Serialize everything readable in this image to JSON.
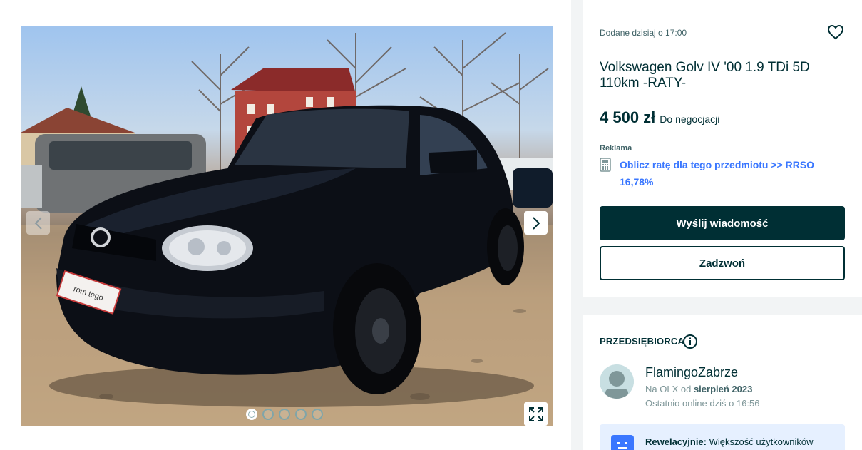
{
  "listing": {
    "added": "Dodane dzisiaj o 17:00",
    "title": "Volkswagen Golv IV '00 1.9 TDi 5D 110km -RATY-",
    "price": "4 500 zł",
    "negotiable": "Do negocjacji",
    "ad_label": "Reklama",
    "calculator_link": "Oblicz ratę dla tego przedmiotu >> RRSO 16,78%",
    "message_button": "Wyślij wiadomość",
    "call_button": "Zadzwoń"
  },
  "gallery": {
    "photo_count": 5,
    "active_index": 0,
    "plate_text": "rom tego"
  },
  "seller": {
    "type_label": "PRZEDSIĘBIORCA",
    "name": "FlamingoZabrze",
    "since_prefix": "Na OLX od",
    "since_date": "sierpień 2023",
    "last_online": "Ostatnio online dziś o 16:56",
    "badge_bold": "Rewelacyjnie:",
    "badge_text": " Większość użytkowników"
  },
  "icons": {
    "favorite": "heart-icon",
    "info": "info-icon",
    "calculator": "calculator-icon",
    "prev": "chevron-left-icon",
    "next": "chevron-right-icon",
    "fullscreen": "expand-icon"
  },
  "colors": {
    "primary": "#002f34",
    "link": "#3a77ff",
    "badge_bg": "#e6f0ff"
  }
}
